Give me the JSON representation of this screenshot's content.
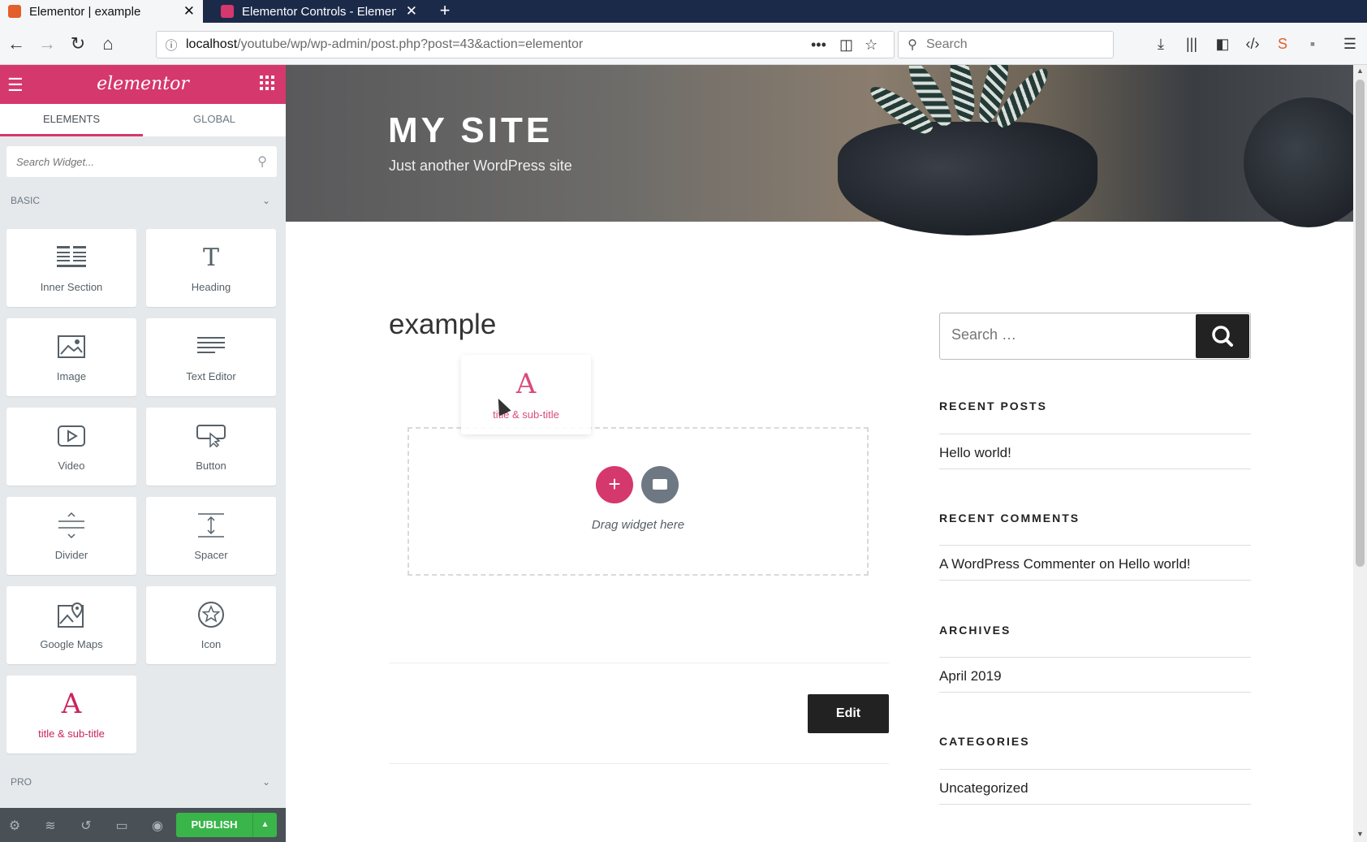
{
  "browser": {
    "tabs": [
      {
        "title": "Elementor | example",
        "active": true,
        "favicon_color": "#e25f2c"
      },
      {
        "title": "Elementor Controls - Elementor",
        "active": false,
        "favicon_color": "#d5386c"
      }
    ],
    "url_host": "localhost",
    "url_path": "/youtube/wp/wp-admin/post.php?post=43&action=elementor",
    "search_placeholder": "Search"
  },
  "panel": {
    "logo": "elementor",
    "tabs": [
      "ELEMENTS",
      "GLOBAL"
    ],
    "active_tab": "ELEMENTS",
    "search_placeholder": "Search Widget...",
    "category_basic": "BASIC",
    "category_pro": "PRO",
    "widgets": [
      {
        "label": "Inner Section",
        "icon": "inner-section-icon"
      },
      {
        "label": "Heading",
        "icon": "heading-icon"
      },
      {
        "label": "Image",
        "icon": "image-icon"
      },
      {
        "label": "Text Editor",
        "icon": "text-editor-icon"
      },
      {
        "label": "Video",
        "icon": "video-icon"
      },
      {
        "label": "Button",
        "icon": "button-icon"
      },
      {
        "label": "Divider",
        "icon": "divider-icon"
      },
      {
        "label": "Spacer",
        "icon": "spacer-icon"
      },
      {
        "label": "Google Maps",
        "icon": "google-maps-icon"
      },
      {
        "label": "Icon",
        "icon": "star-icon"
      },
      {
        "label": "title & sub-title",
        "icon": "letter-a-icon",
        "glyph": "A"
      }
    ],
    "publish_label": "PUBLISH",
    "accent": "#d5386c",
    "publish_color": "#39b54a"
  },
  "preview": {
    "site_title": "MY SITE",
    "site_description": "Just another WordPress site",
    "post_title": "example",
    "drag_ghost_label": "title & sub-title",
    "drag_ghost_glyph": "A",
    "drag_text": "Drag widget here",
    "add_glyph": "+",
    "edit_label": "Edit",
    "sidebar": {
      "search_placeholder": "Search …",
      "recent_posts_heading": "RECENT POSTS",
      "recent_posts": [
        "Hello world!"
      ],
      "recent_comments_heading": "RECENT COMMENTS",
      "comment_author": "A WordPress Commenter",
      "comment_on": "on",
      "comment_post": "Hello world!",
      "archives_heading": "ARCHIVES",
      "archives": [
        "April 2019"
      ],
      "categories_heading": "CATEGORIES",
      "categories": [
        "Uncategorized"
      ]
    }
  }
}
